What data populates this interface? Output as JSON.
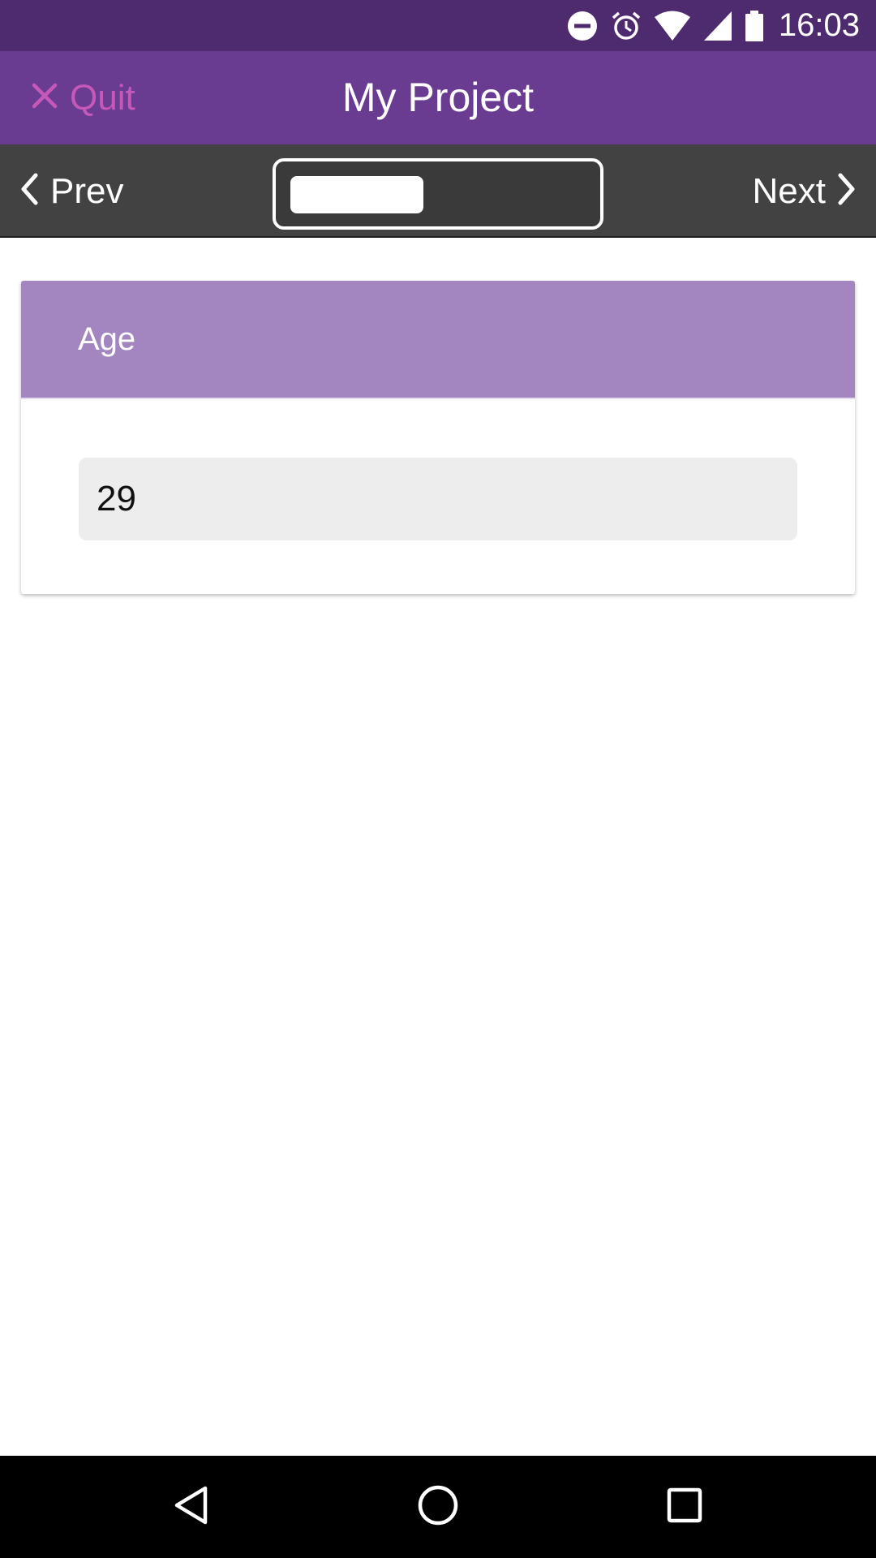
{
  "status_bar": {
    "time": "16:03",
    "icons": [
      "do-not-disturb-icon",
      "alarm-icon",
      "wifi-icon",
      "cell-signal-icon",
      "battery-icon"
    ]
  },
  "app_bar": {
    "quit_label": "Quit",
    "title": "My Project",
    "quit_color": "#c558b8",
    "background": "#693b91"
  },
  "nav_bar": {
    "prev_label": "Prev",
    "next_label": "Next",
    "progress": 0.45
  },
  "question": {
    "label": "Age",
    "answer": "29",
    "header_color": "#a386bf"
  },
  "system_nav": {
    "buttons": [
      "back-icon",
      "home-icon",
      "recents-icon"
    ]
  }
}
